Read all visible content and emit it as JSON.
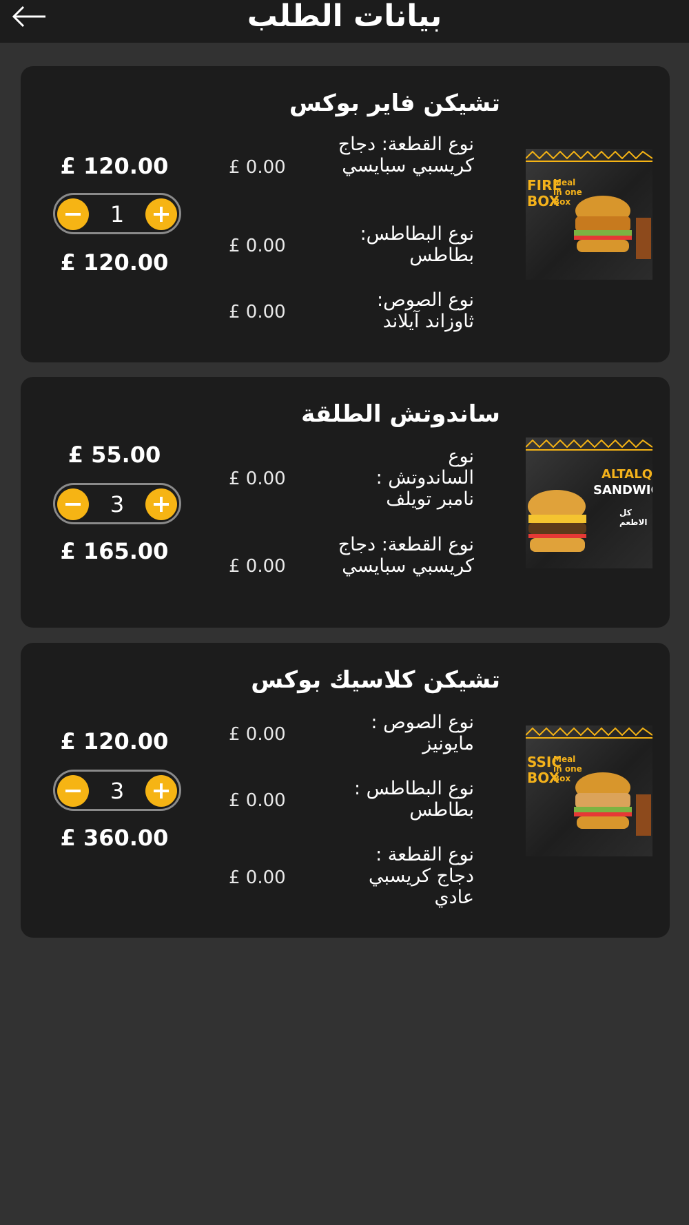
{
  "header": {
    "title": "بيانات الطلب",
    "back_icon": "arrow-left-icon"
  },
  "currency": "£",
  "items": [
    {
      "name": "تشيكن فاير بوكس",
      "thumb_text": [
        "FIRE",
        "BOX"
      ],
      "thumb_subtext": [
        "Meal",
        "in one",
        "Box"
      ],
      "options": [
        {
          "label": "نوع القطعة: دجاج كريسبي سبايسي",
          "price": "£ 0.00"
        },
        {
          "label": "نوع البطاطس: بطاطس",
          "price": "£ 0.00"
        },
        {
          "label": "نوع الصوص: ثاوزاند آيلاند",
          "price": "£ 0.00"
        }
      ],
      "unit_price": "£ 120.00",
      "quantity": "1",
      "total_price": "£ 120.00"
    },
    {
      "name": "ساندوتش الطلقة",
      "thumb_text": [
        "ALTALQA",
        "SANDWICH"
      ],
      "thumb_subtext": [
        "كل الاطعم"
      ],
      "options": [
        {
          "label": "نوع الساندوتش : نامبر تويلف",
          "price": "£ 0.00"
        },
        {
          "label": "نوع القطعة: دجاج كريسبي سبايسي",
          "price": "£ 0.00"
        }
      ],
      "unit_price": "£ 55.00",
      "quantity": "3",
      "total_price": "£ 165.00"
    },
    {
      "name": "تشيكن كلاسيك بوكس",
      "thumb_text": [
        "SSIC",
        "BOX"
      ],
      "thumb_subtext": [
        "Meal",
        "in one",
        "Box"
      ],
      "options": [
        {
          "label": "نوع الصوص : مايونيز",
          "price": "£ 0.00"
        },
        {
          "label": "نوع البطاطس : بطاطس",
          "price": "£ 0.00"
        },
        {
          "label": "نوع القطعة : دجاج كريسبي عادي",
          "price": "£ 0.00"
        }
      ],
      "unit_price": "£ 120.00",
      "quantity": "3",
      "total_price": "£ 360.00"
    }
  ],
  "colors": {
    "background": "#323232",
    "card": "#1c1c1c",
    "accent": "#f6b414",
    "stepper_border": "#8a8a8a"
  }
}
